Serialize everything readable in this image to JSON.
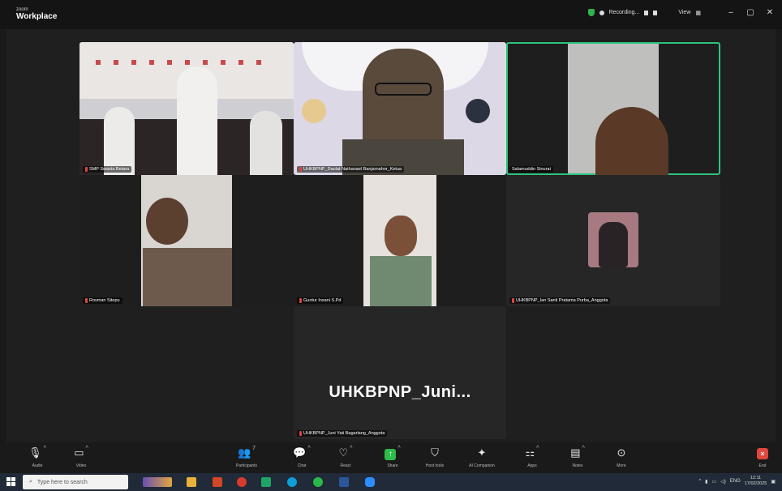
{
  "titlebar": {
    "brand_small": "zoom",
    "brand": "Workplace",
    "recording": "Recording...",
    "view": "View"
  },
  "participants": [
    {
      "id": "tile-1",
      "name": "SMP Swasta Betara"
    },
    {
      "id": "tile-2",
      "name": "UHKBPNP_Daulat Nathanael Banjarnahor_Ketua"
    },
    {
      "id": "tile-3",
      "name": "Salamuddin Sinurat"
    },
    {
      "id": "tile-4",
      "name": "Rosman Sitepu"
    },
    {
      "id": "tile-5",
      "name": "Guntur Insani S.Pd"
    },
    {
      "id": "tile-6",
      "name": "UHKBPNP_Ian Santi Pratama Purba_Anggota"
    },
    {
      "id": "tile-7",
      "name": "UHKBPNP_Juni Yati Bagarlang_Anggota"
    }
  ],
  "big_name": "UHKBPNP_Juni...",
  "toolbar": {
    "audio": "Audio",
    "video": "Video",
    "participants": "Participants",
    "participants_count": "7",
    "chat": "Chat",
    "react": "React",
    "share": "Share",
    "host_tools": "Host tools",
    "ai_companion": "AI Companion",
    "apps": "Apps",
    "notes": "Notes",
    "more": "More",
    "end": "End"
  },
  "taskbar": {
    "search_placeholder": "Type here to search",
    "lang": "ENG",
    "time": "12:11",
    "date": "17/02/2025"
  },
  "colors": {
    "active_speaker": "#2ec27e",
    "share": "#2ebb4a",
    "end": "#e0463b"
  }
}
